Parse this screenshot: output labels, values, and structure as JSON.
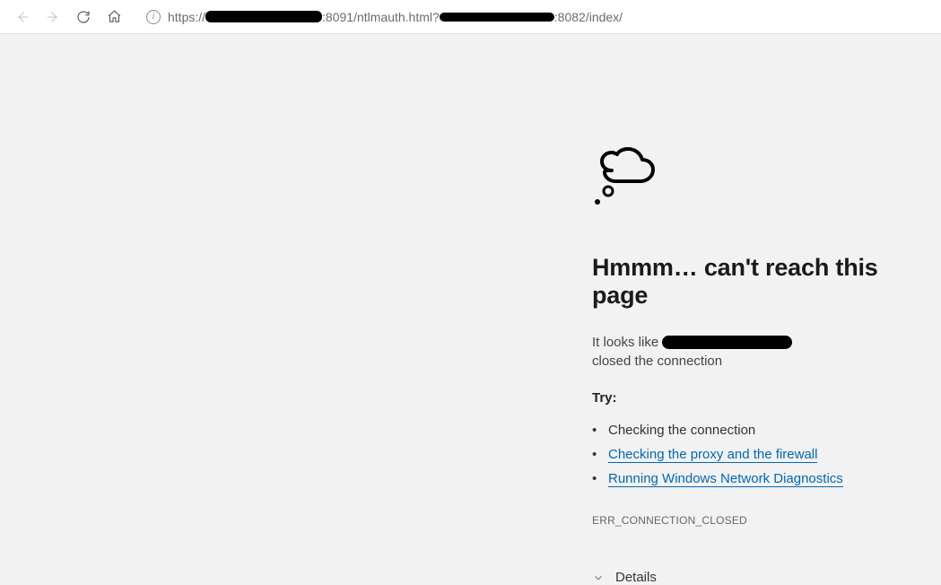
{
  "toolbar": {
    "url_prefix": "https://",
    "url_mid1": ":8091/ntlmauth.html?",
    "url_mid2": ":8082/index/"
  },
  "error": {
    "title": "Hmmm… can't reach this page",
    "desc_pre": "It looks like",
    "desc_post": "closed the connection",
    "try_label": "Try:",
    "items": {
      "check_conn": "Checking the connection",
      "check_proxy": "Checking the proxy and the firewall",
      "run_diag": "Running Windows Network Diagnostics"
    },
    "code": "ERR_CONNECTION_CLOSED",
    "details": "Details"
  }
}
